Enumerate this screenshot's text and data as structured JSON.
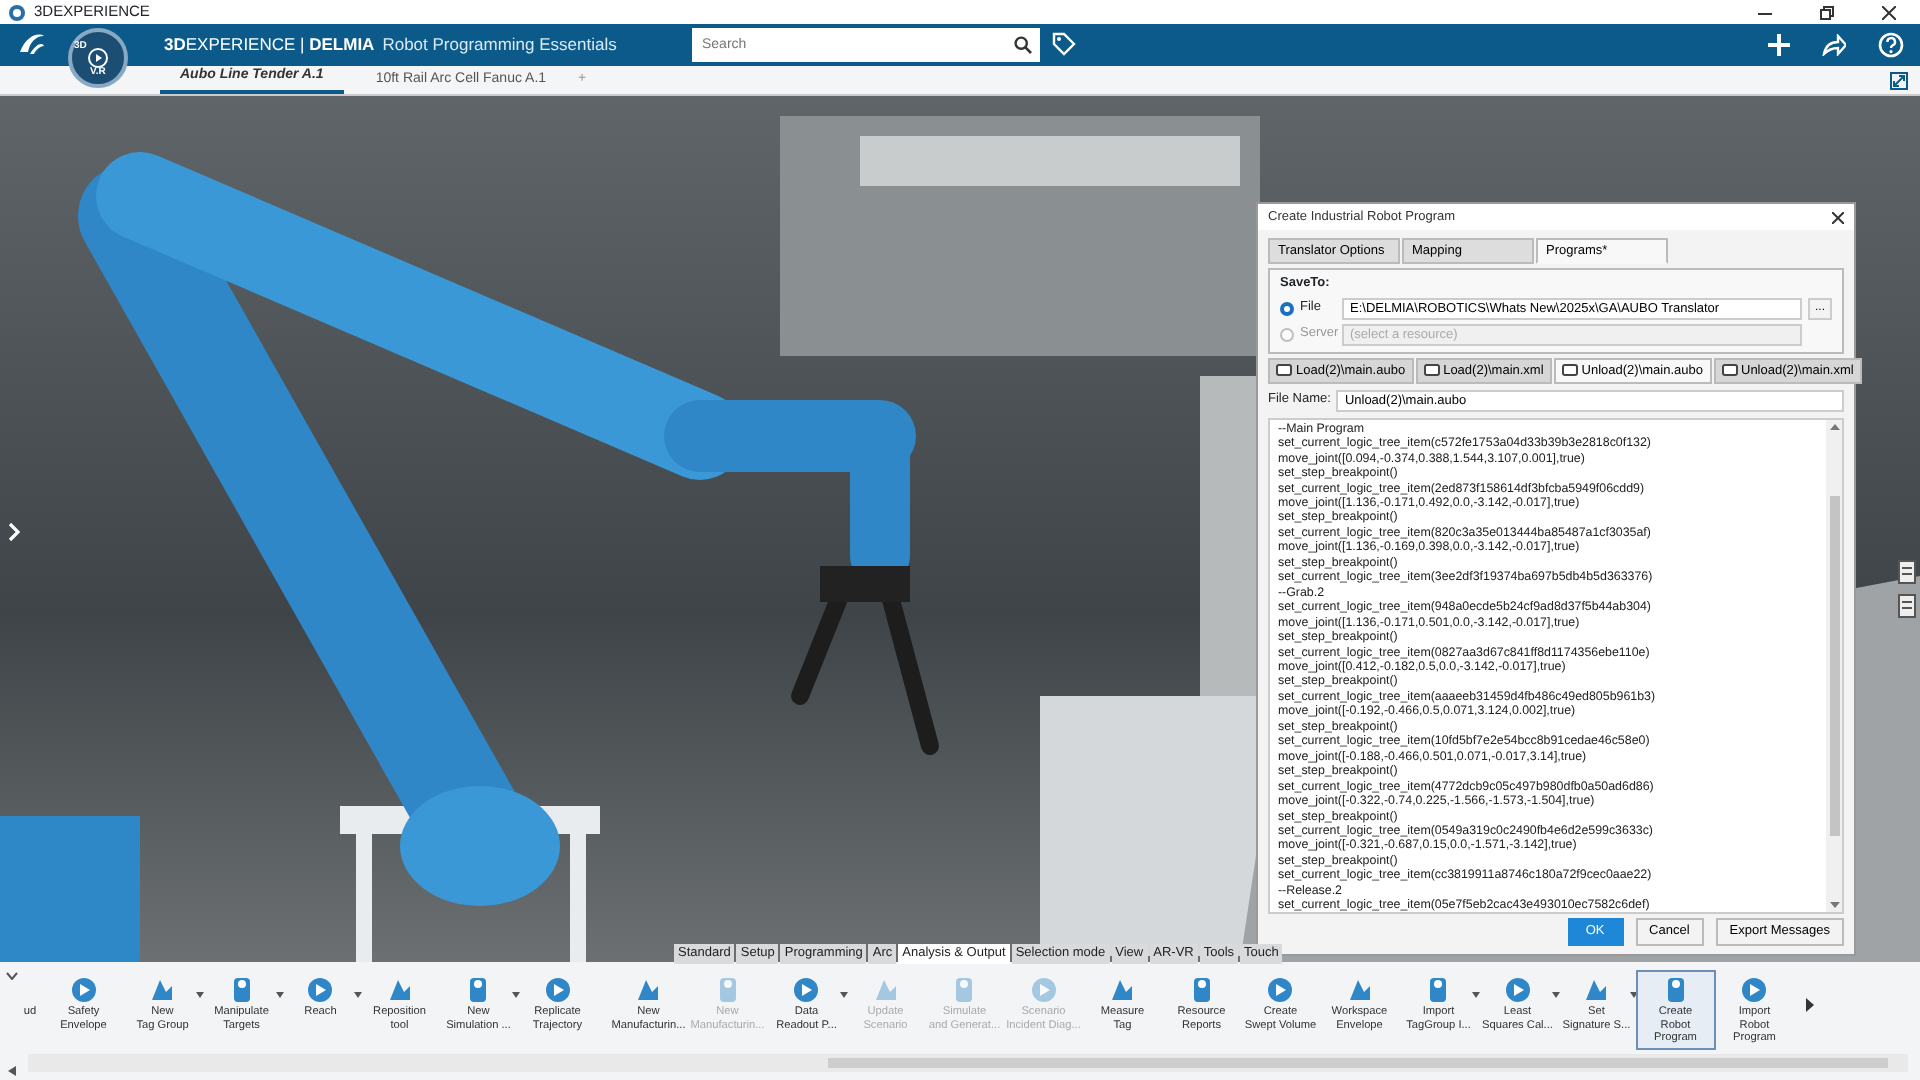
{
  "window": {
    "title": "3DEXPERIENCE"
  },
  "header": {
    "brand": "**3D**EXPERIENCE | **DELMIA**",
    "app": "Robot Programming Essentials",
    "compass_text": "3D",
    "compass_label": "V.R",
    "search": {
      "placeholder": "Search"
    }
  },
  "tabs": [
    {
      "label": "Aubo Line Tender A.1",
      "selected": true
    },
    {
      "label": "10ft Rail Arc Cell Fanuc A.1",
      "selected": false
    }
  ],
  "add_tab": "+",
  "dialog": {
    "title": "Create Industrial Robot Program",
    "tabs": [
      {
        "label": "Translator Options",
        "selected": false
      },
      {
        "label": "Mapping",
        "selected": false
      },
      {
        "label": "Programs*",
        "selected": true
      }
    ],
    "save_to": {
      "title": "SaveTo:",
      "options": [
        {
          "label": "File",
          "selected": true,
          "disabled": false,
          "value": "E:\\DELMIA\\ROBOTICS\\Whats New\\2025x\\GA\\AUBO Translator"
        },
        {
          "label": "Server",
          "selected": false,
          "disabled": true,
          "placeholder": "(select a resource)"
        }
      ],
      "browse": "..."
    },
    "file_tabs": [
      {
        "label": "Load(2)\\main.aubo",
        "selected": false
      },
      {
        "label": "Load(2)\\main.xml",
        "selected": false
      },
      {
        "label": "Unload(2)\\main.aubo",
        "selected": true
      },
      {
        "label": "Unload(2)\\main.xml",
        "selected": false
      }
    ],
    "file_name": {
      "label": "File Name:",
      "value": "Unload(2)\\main.aubo"
    },
    "code_lines": [
      "--Main Program",
      "set_current_logic_tree_item(c572fe1753a04d33b39b3e2818c0f132)",
      "move_joint([0.094,-0.374,0.388,1.544,3.107,0.001],true)",
      "set_step_breakpoint()",
      "set_current_logic_tree_item(2ed873f158614df3bfcba5949f06cdd9)",
      "move_joint([1.136,-0.171,0.492,0.0,-3.142,-0.017],true)",
      "set_step_breakpoint()",
      "set_current_logic_tree_item(820c3a35e013444ba85487a1cf3035af)",
      "move_joint([1.136,-0.169,0.398,0.0,-3.142,-0.017],true)",
      "set_step_breakpoint()",
      "set_current_logic_tree_item(3ee2df3f19374ba697b5db4b5d363376)",
      "--Grab.2",
      "set_current_logic_tree_item(948a0ecde5b24cf9ad8d37f5b44ab304)",
      "move_joint([1.136,-0.171,0.501,0.0,-3.142,-0.017],true)",
      "set_step_breakpoint()",
      "set_current_logic_tree_item(0827aa3d67c841ff8d1174356ebe110e)",
      "move_joint([0.412,-0.182,0.5,0.0,-3.142,-0.017],true)",
      "set_step_breakpoint()",
      "set_current_logic_tree_item(aaaeeb31459d4fb486c49ed805b961b3)",
      "move_joint([-0.192,-0.466,0.5,0.071,3.124,0.002],true)",
      "set_step_breakpoint()",
      "set_current_logic_tree_item(10fd5bf7e2e54bcc8b91cedae46c58e0)",
      "move_joint([-0.188,-0.466,0.501,0.071,-0.017,3.14],true)",
      "set_step_breakpoint()",
      "set_current_logic_tree_item(4772dcb9c05c497b980dfb0a50ad6d86)",
      "move_joint([-0.322,-0.74,0.225,-1.566,-1.573,-1.504],true)",
      "set_step_breakpoint()",
      "set_current_logic_tree_item(0549a319c0c2490fb4e6d2e599c3633c)",
      "move_joint([-0.321,-0.687,0.15,0.0,-1.571,-3.142],true)",
      "set_step_breakpoint()",
      "set_current_logic_tree_item(cc3819911a8746c180a72f9cec0aae22)",
      "--Release.2",
      "set_current_logic_tree_item(05e7f5eb2cac43e493010ec7582c6def)"
    ],
    "buttons": [
      {
        "label": "OK",
        "kind": "primary"
      },
      {
        "label": "Cancel",
        "kind": "secondary"
      },
      {
        "label": "Export Messages",
        "kind": "secondary"
      }
    ]
  },
  "command_tabs": [
    {
      "label": "Standard",
      "selected": false
    },
    {
      "label": "Setup",
      "selected": false
    },
    {
      "label": "Programming",
      "selected": false
    },
    {
      "label": "Arc",
      "selected": false
    },
    {
      "label": "Analysis & Output",
      "selected": true
    },
    {
      "label": "Selection mode",
      "selected": false
    },
    {
      "label": "View",
      "selected": false
    },
    {
      "label": "AR-VR",
      "selected": false
    },
    {
      "label": "Tools",
      "selected": false
    },
    {
      "label": "Touch",
      "selected": false
    }
  ],
  "toolbar": [
    {
      "label": "ud",
      "kind": "partial",
      "caret": false,
      "disabled": false,
      "selected": false
    },
    {
      "label": "Safety\nEnvelope",
      "kind": "command",
      "caret": false,
      "disabled": false,
      "selected": false
    },
    {
      "label": "New\nTag Group",
      "kind": "command",
      "caret": true,
      "disabled": false,
      "selected": false
    },
    {
      "label": "Manipulate\nTargets",
      "kind": "command",
      "caret": true,
      "disabled": false,
      "selected": false
    },
    {
      "label": "Reach",
      "kind": "command",
      "caret": true,
      "disabled": false,
      "selected": false
    },
    {
      "label": "Reposition\ntool",
      "kind": "command",
      "caret": false,
      "disabled": false,
      "selected": false
    },
    {
      "label": "New\nSimulation ...",
      "kind": "command",
      "caret": true,
      "disabled": false,
      "selected": false
    },
    {
      "label": "Replicate\nTrajectory",
      "kind": "command",
      "caret": false,
      "disabled": false,
      "selected": false
    },
    {
      "label": "New\nManufacturin...",
      "kind": "command",
      "caret": false,
      "disabled": false,
      "selected": false
    },
    {
      "label": "New\nManufacturin...",
      "kind": "command",
      "caret": false,
      "disabled": true,
      "selected": false
    },
    {
      "label": "Data\nReadout P...",
      "kind": "command",
      "caret": true,
      "disabled": false,
      "selected": false
    },
    {
      "label": "Update\nScenario",
      "kind": "command",
      "caret": false,
      "disabled": true,
      "selected": false
    },
    {
      "label": "Simulate\nand Generat...",
      "kind": "command",
      "caret": false,
      "disabled": true,
      "selected": false
    },
    {
      "label": "Scenario\nIncident Diag...",
      "kind": "command",
      "caret": false,
      "disabled": true,
      "selected": false
    },
    {
      "label": "Measure\nTag",
      "kind": "command",
      "caret": false,
      "disabled": false,
      "selected": false
    },
    {
      "label": "Resource\nReports",
      "kind": "command",
      "caret": false,
      "disabled": false,
      "selected": false
    },
    {
      "label": "Create\nSwept Volume",
      "kind": "command",
      "caret": false,
      "disabled": false,
      "selected": false
    },
    {
      "label": "Workspace\nEnvelope",
      "kind": "command",
      "caret": false,
      "disabled": false,
      "selected": false
    },
    {
      "label": "Import\nTagGroup I...",
      "kind": "command",
      "caret": true,
      "disabled": false,
      "selected": false
    },
    {
      "label": "Least\nSquares Cal...",
      "kind": "command",
      "caret": true,
      "disabled": false,
      "selected": false
    },
    {
      "label": "Set\nSignature S...",
      "kind": "command",
      "caret": true,
      "disabled": false,
      "selected": false
    },
    {
      "label": "Create\nRobot Program",
      "kind": "command",
      "caret": false,
      "disabled": false,
      "selected": true
    },
    {
      "label": "Import\nRobot Program",
      "kind": "command",
      "caret": false,
      "disabled": false,
      "selected": false
    }
  ]
}
